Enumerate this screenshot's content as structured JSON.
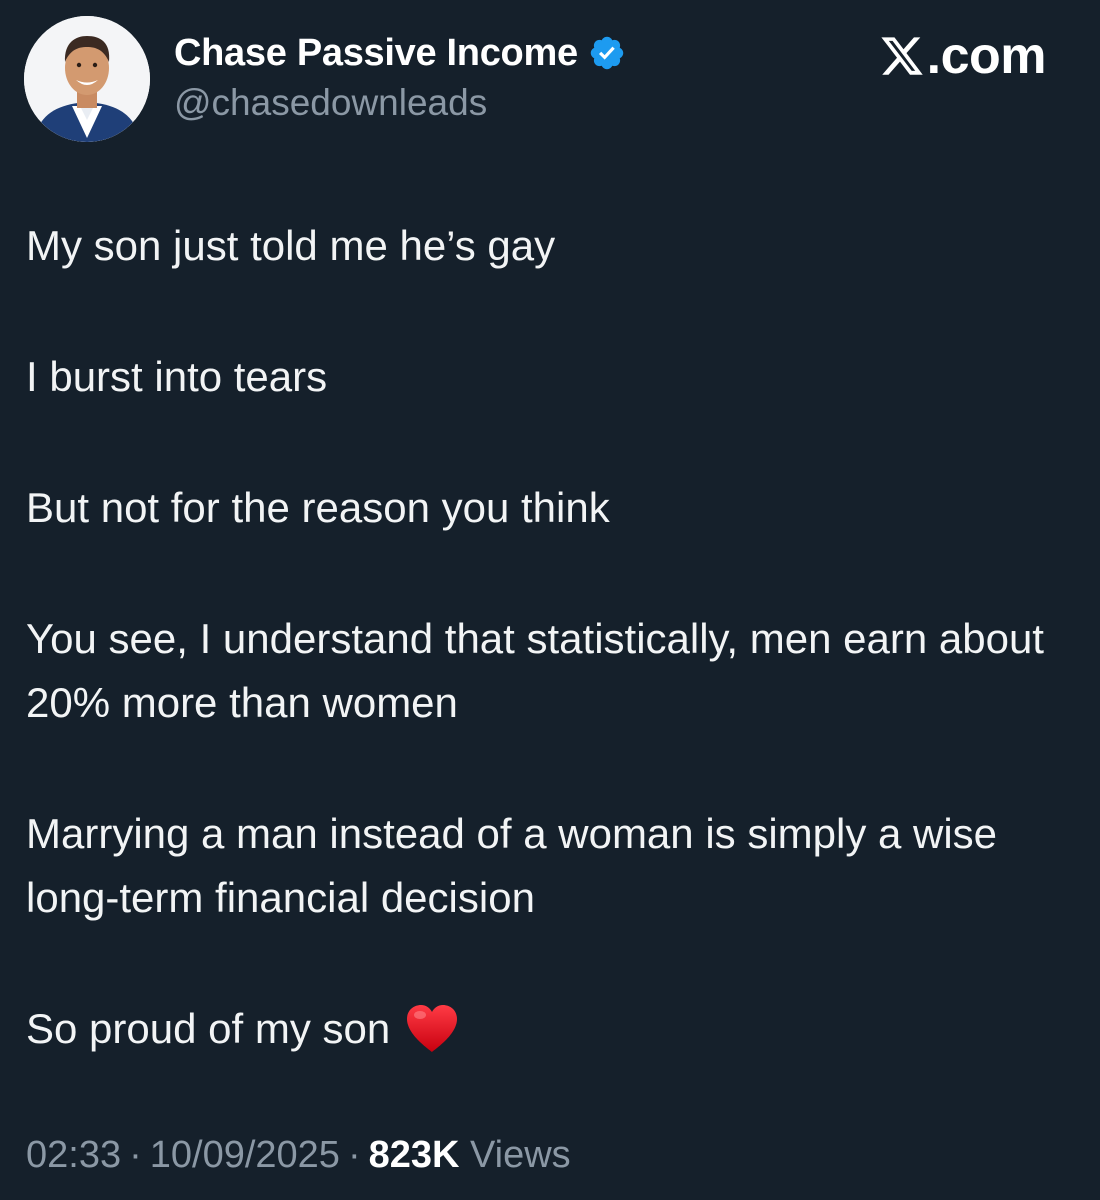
{
  "author": {
    "display_name": "Chase Passive Income",
    "handle": "@chasedownleads",
    "verified_icon": "verified-badge-icon",
    "avatar_icon": "profile-photo"
  },
  "brand": {
    "logo_icon": "x-logo-icon",
    "suffix": ".com"
  },
  "tweet": {
    "paragraphs": [
      "My son just told me he’s gay",
      "I burst into tears",
      "But not for the reason you think",
      "You see, I understand that statistically, men earn about 20% more than women",
      "Marrying a man instead of a woman is simply a wise long-term financial decision",
      "So proud of my son"
    ],
    "emoji_icon": "red-heart-icon"
  },
  "meta": {
    "time": "02:33",
    "separator": "·",
    "date": "10/09/2025",
    "views_count": "823K",
    "views_label": "Views"
  },
  "colors": {
    "background": "#15202b",
    "verified": "#1d9bf0",
    "secondary_text": "#8b98a5",
    "heart": "#e0101e"
  }
}
